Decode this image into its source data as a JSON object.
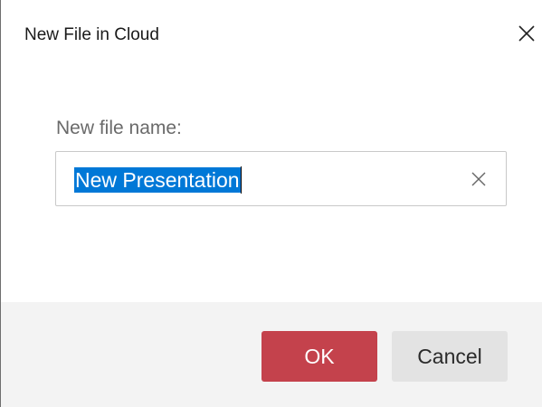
{
  "dialog": {
    "title": "New File in Cloud",
    "close_icon": "close-icon"
  },
  "form": {
    "label": "New file name:",
    "value": "New Presentation",
    "value_selected": true,
    "clear_icon": "clear-icon"
  },
  "buttons": {
    "ok_label": "OK",
    "cancel_label": "Cancel"
  },
  "colors": {
    "ok_button": "#c4424c",
    "cancel_button": "#e3e3e3",
    "selection": "#0078d7",
    "footer": "#f3f3f3"
  }
}
